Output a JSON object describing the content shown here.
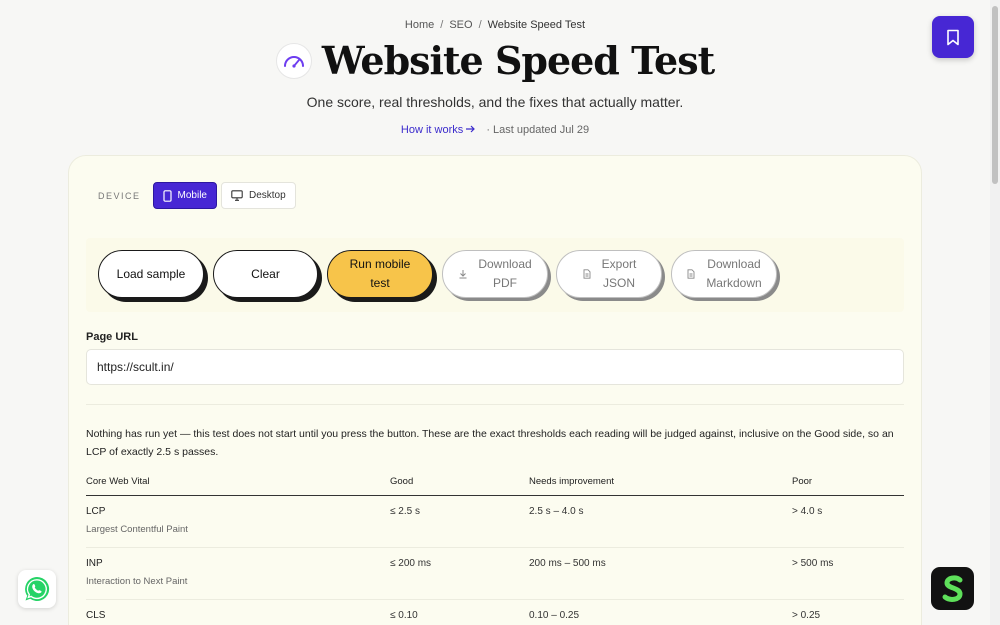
{
  "breadcrumb": {
    "items": [
      "Home",
      "SEO",
      "Website Speed Test"
    ],
    "separator": "/"
  },
  "header": {
    "title": "Website Speed Test",
    "subtitle": "One score, real thresholds, and the fixes that actually matter.",
    "how_it_works": "How it works",
    "last_updated": "· Last updated Jul 29"
  },
  "device": {
    "label": "DEVICE",
    "options": [
      "Mobile",
      "Desktop"
    ],
    "selected": "Mobile"
  },
  "actions": {
    "load_sample": "Load sample",
    "clear": "Clear",
    "run_line1": "Run mobile",
    "run_line2": "test",
    "pdf_line1": "Download",
    "pdf_line2": "PDF",
    "json_line1": "Export",
    "json_line2": "JSON",
    "md_line1": "Download",
    "md_line2": "Markdown"
  },
  "url": {
    "label": "Page URL",
    "value": "https://scult.in/"
  },
  "notice": "Nothing has run yet — this test does not start until you press the button. These are the exact thresholds each reading will be judged against, inclusive on the Good side, so an LCP of exactly 2.5 s passes.",
  "table": {
    "headers": [
      "Core Web Vital",
      "Good",
      "Needs improvement",
      "Poor"
    ],
    "rows": [
      {
        "name": "LCP",
        "desc": "Largest Contentful Paint",
        "good": "≤ 2.5 s",
        "needs": "2.5 s – 4.0 s",
        "poor": "> 4.0 s"
      },
      {
        "name": "INP",
        "desc": "Interaction to Next Paint",
        "good": "≤ 200 ms",
        "needs": "200 ms – 500 ms",
        "poor": "> 500 ms"
      },
      {
        "name": "CLS",
        "desc": "",
        "good": "≤ 0.10",
        "needs": "0.10 – 0.25",
        "poor": "> 0.25"
      }
    ]
  },
  "colors": {
    "accent": "#4727d4",
    "run_button": "#f7c44a",
    "card_bg": "#fcfcf0",
    "page_bg": "#f7f7f5"
  },
  "icons": [
    "gauge-icon",
    "bookmark-icon",
    "phone-icon",
    "monitor-icon",
    "download-icon",
    "file-icon",
    "arrow-right-icon",
    "whatsapp-icon",
    "brand-logo-icon"
  ]
}
